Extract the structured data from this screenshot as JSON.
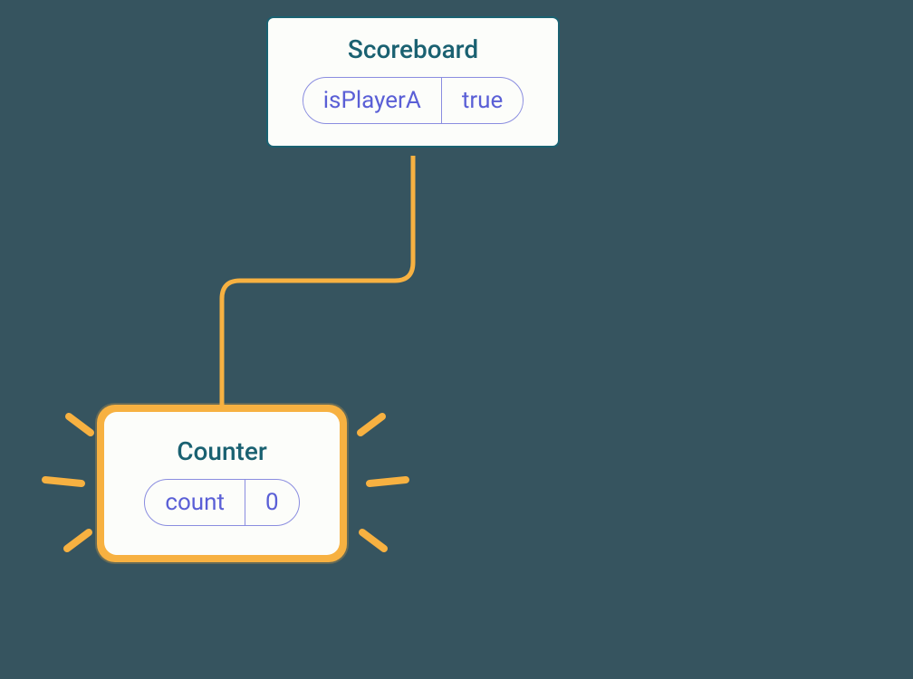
{
  "nodes": {
    "scoreboard": {
      "title": "Scoreboard",
      "state_key": "isPlayerA",
      "state_value": "true"
    },
    "counter": {
      "title": "Counter",
      "state_key": "count",
      "state_value": "0"
    }
  },
  "colors": {
    "bg": "#36545f",
    "card_bg": "#fcfdfa",
    "card_border": "#1a6171",
    "pill_border": "#8a8de0",
    "pill_text": "#5a5fd6",
    "highlight": "#f7b141"
  }
}
